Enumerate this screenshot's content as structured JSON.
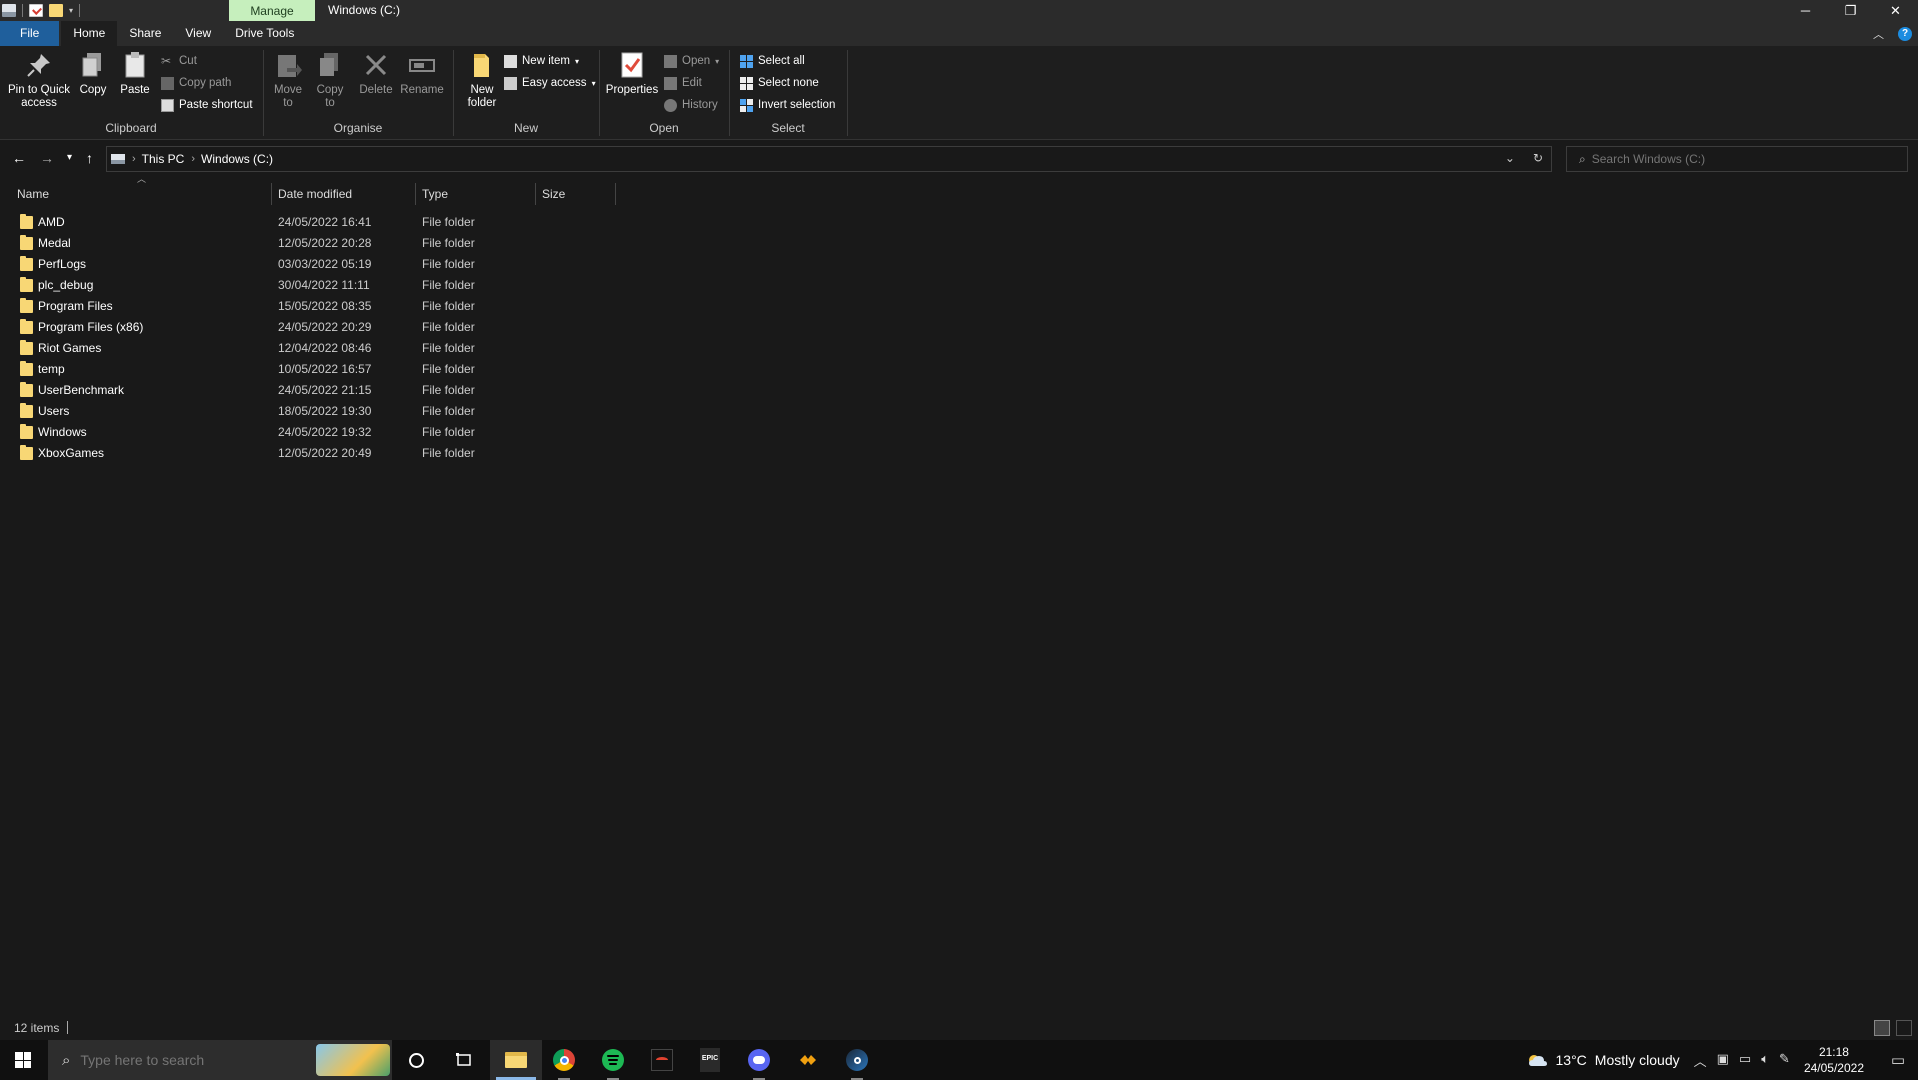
{
  "titlebar": {
    "manage_tab": "Manage",
    "title": "Windows (C:)",
    "minimize": "─",
    "restore": "❐",
    "close": "✕"
  },
  "ribbon_tabs": [
    "File",
    "Home",
    "Share",
    "View",
    "Drive Tools"
  ],
  "ribbon": {
    "clipboard": {
      "pin_label": "Pin to Quick access",
      "copy_label": "Copy",
      "paste_label": "Paste",
      "cut_label": "Cut",
      "copy_path_label": "Copy path",
      "paste_shortcut_label": "Paste shortcut",
      "group_label": "Clipboard"
    },
    "organise": {
      "move_to_label": "Move to",
      "copy_to_label": "Copy to",
      "delete_label": "Delete",
      "rename_label": "Rename",
      "group_label": "Organise"
    },
    "new": {
      "new_folder_label": "New folder",
      "new_item_label": "New item",
      "easy_access_label": "Easy access",
      "group_label": "New"
    },
    "open": {
      "properties_label": "Properties",
      "open_label": "Open",
      "edit_label": "Edit",
      "history_label": "History",
      "group_label": "Open"
    },
    "select": {
      "select_all_label": "Select all",
      "select_none_label": "Select none",
      "invert_label": "Invert selection",
      "group_label": "Select"
    }
  },
  "address": {
    "crumbs": [
      "This PC",
      "Windows (C:)"
    ],
    "search_placeholder": "Search Windows (C:)"
  },
  "columns": [
    "Name",
    "Date modified",
    "Type",
    "Size"
  ],
  "files": [
    {
      "name": "AMD",
      "date": "24/05/2022 16:41",
      "type": "File folder"
    },
    {
      "name": "Medal",
      "date": "12/05/2022 20:28",
      "type": "File folder"
    },
    {
      "name": "PerfLogs",
      "date": "03/03/2022 05:19",
      "type": "File folder"
    },
    {
      "name": "plc_debug",
      "date": "30/04/2022 11:11",
      "type": "File folder"
    },
    {
      "name": "Program Files",
      "date": "15/05/2022 08:35",
      "type": "File folder"
    },
    {
      "name": "Program Files (x86)",
      "date": "24/05/2022 20:29",
      "type": "File folder"
    },
    {
      "name": "Riot Games",
      "date": "12/04/2022 08:46",
      "type": "File folder"
    },
    {
      "name": "temp",
      "date": "10/05/2022 16:57",
      "type": "File folder"
    },
    {
      "name": "UserBenchmark",
      "date": "24/05/2022 21:15",
      "type": "File folder"
    },
    {
      "name": "Users",
      "date": "18/05/2022 19:30",
      "type": "File folder"
    },
    {
      "name": "Windows",
      "date": "24/05/2022 19:32",
      "type": "File folder"
    },
    {
      "name": "XboxGames",
      "date": "12/05/2022 20:49",
      "type": "File folder"
    }
  ],
  "status": {
    "item_count": "12 items"
  },
  "taskbar": {
    "search_placeholder": "Type here to search",
    "apps": [
      "cortana-icon",
      "task-view-icon",
      "file-explorer-icon",
      "chrome-icon",
      "spotify-icon",
      "ryzen-master-icon",
      "epic-games-icon",
      "discord-icon",
      "rainmeter-icon",
      "steam-icon"
    ],
    "epic_label": "EPIC",
    "temperature": "13°C",
    "weather": "Mostly cloudy",
    "time": "21:18",
    "date": "24/05/2022"
  },
  "colors": {
    "folder": "#f8d775",
    "file_tab": "#1f5f9c",
    "manage_tab": "#c6efbd",
    "background": "#191919"
  }
}
